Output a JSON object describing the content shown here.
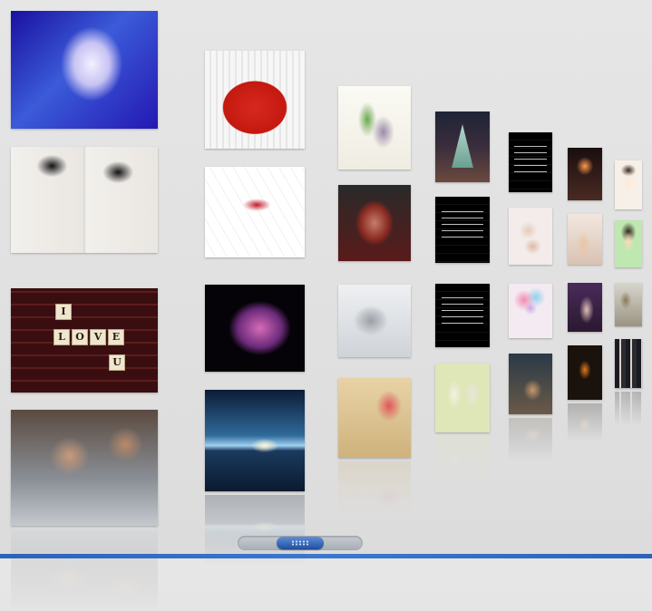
{
  "gallery": {
    "tiles": [
      {
        "art": "concert",
        "caption": "",
        "reflect": false
      },
      {
        "art": "redcity",
        "caption": "",
        "reflect": false
      },
      {
        "art": "cactus",
        "caption": "",
        "reflect": false
      },
      {
        "art": "triangle",
        "caption": "",
        "reflect": false
      },
      {
        "art": "textblack",
        "caption": "",
        "reflect": false
      },
      {
        "art": "heartlight",
        "caption": "",
        "reflect": false
      },
      {
        "art": "cartoon",
        "caption": "",
        "reflect": false
      },
      {
        "art": "girlduo",
        "caption": "",
        "reflect": false
      },
      {
        "art": "sketch",
        "caption": "",
        "reflect": false
      },
      {
        "art": "bloodface",
        "caption": "",
        "reflect": false
      },
      {
        "art": "textblack",
        "caption": "",
        "reflect": false
      },
      {
        "art": "bodies",
        "caption": "",
        "reflect": false
      },
      {
        "art": "handhold",
        "caption": "",
        "reflect": false
      },
      {
        "art": "cartoon2",
        "caption": "",
        "reflect": false
      },
      {
        "art": "loveu",
        "caption": "",
        "reflect": false
      },
      {
        "art": "purplecat",
        "caption": "",
        "reflect": false
      },
      {
        "art": "hips",
        "caption": "",
        "reflect": false
      },
      {
        "art": "textblack",
        "caption": "",
        "reflect": false
      },
      {
        "art": "balloons",
        "caption": "",
        "reflect": false
      },
      {
        "art": "purplehand",
        "caption": "",
        "reflect": false
      },
      {
        "art": "leaves",
        "caption": "",
        "reflect": false
      },
      {
        "art": "boys",
        "caption": "",
        "reflect": true
      },
      {
        "art": "sunset",
        "caption": "",
        "reflect": true
      },
      {
        "art": "heartpaper",
        "caption": "",
        "reflect": true
      },
      {
        "art": "couple",
        "caption": "",
        "reflect": true
      },
      {
        "art": "guitar",
        "caption": "",
        "reflect": true
      },
      {
        "art": "monkey",
        "caption": "",
        "reflect": true
      },
      {
        "art": "group",
        "caption": "",
        "reflect": true
      }
    ],
    "love_letters": [
      "I",
      "L",
      "O",
      "V",
      "E",
      "U"
    ]
  },
  "scrollbar": {
    "position": 0.5
  },
  "colors": {
    "accent": "#2c63b9",
    "background": "#e3e3e3"
  }
}
